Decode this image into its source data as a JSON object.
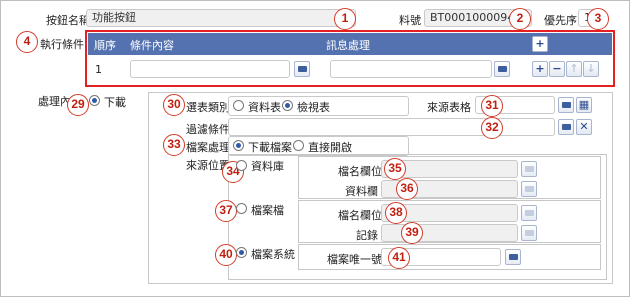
{
  "header": {
    "button_name_label": "按鈕名稱",
    "button_name_value": "功能按鈕",
    "material_no_label": "料號",
    "material_no_value": "BT000100009417",
    "priority_label": "優先序",
    "priority_value": "1"
  },
  "condition": {
    "label": "執行條件",
    "columns": [
      "順序",
      "條件內容",
      "訊息處理"
    ],
    "rows": [
      {
        "order": "1",
        "content": "",
        "message": ""
      }
    ],
    "add_button": "+",
    "row_add": "+",
    "row_remove": "−",
    "row_up": "↑",
    "row_down": "↓"
  },
  "process": {
    "label": "處理內容",
    "download_label": "下載",
    "sheet_type_label": "選表類別",
    "sheet_type_opt1": "資料表",
    "sheet_type_opt2": "檢視表",
    "source_sheet_label": "來源表格",
    "source_sheet_value": "",
    "filter_label": "過濾條件",
    "filter_value": "",
    "file_handle_label": "檔案處理",
    "file_handle_opt1": "下載檔案",
    "file_handle_opt2": "直接開啟",
    "source_location_label": "來源位置",
    "database_label": "資料庫",
    "db_filename_field_label": "檔名欄位",
    "db_data_field_label": "資料欄",
    "file_archive_label": "檔案檔",
    "fa_filename_field_label": "檔名欄位",
    "fa_record_label": "記錄",
    "file_system_label": "檔案系統",
    "fs_unique_name_label": "檔案唯一號",
    "fs_unique_name_value": ""
  },
  "markers": [
    "1",
    "2",
    "3",
    "4",
    "29",
    "30",
    "31",
    "32",
    "33",
    "34",
    "35",
    "36",
    "37",
    "38",
    "39",
    "40",
    "41"
  ],
  "colors": {
    "header_blue": "#5472b0",
    "marker_red": "#d23c2a",
    "highlight_red": "#e52020"
  },
  "icons": {
    "folder": "folder-open-icon",
    "calendar": "calendar-icon",
    "clear": "clear-x-icon"
  }
}
